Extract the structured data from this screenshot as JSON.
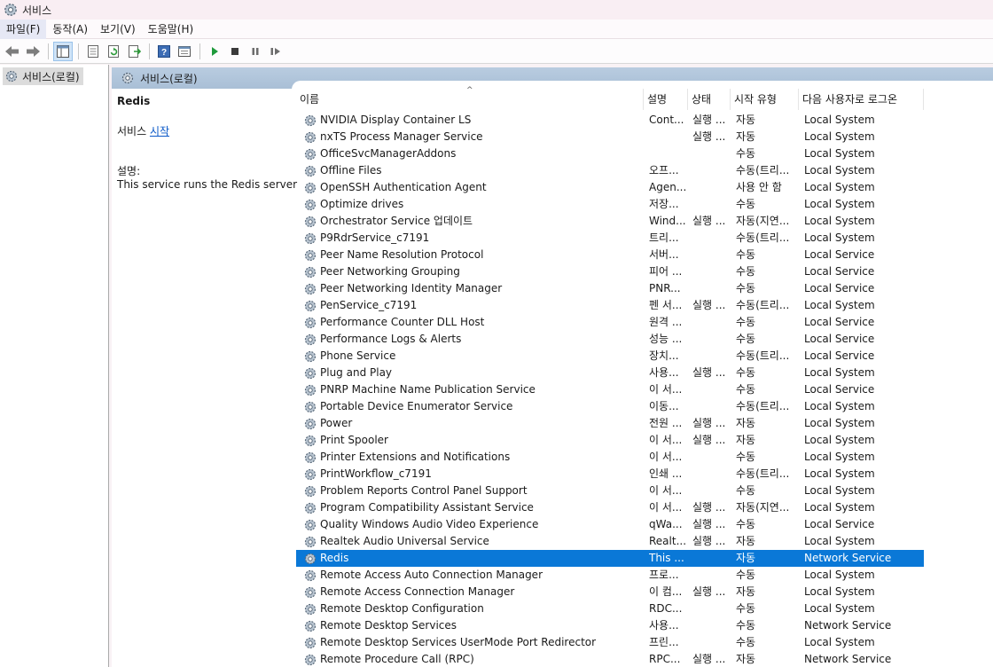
{
  "window": {
    "title": "서비스"
  },
  "menu": [
    "파일(F)",
    "동작(A)",
    "보기(V)",
    "도움말(H)"
  ],
  "toolbar": {
    "buttons": [
      "back-icon",
      "forward-icon",
      "show-hide-tree-icon",
      "properties-icon",
      "refresh-icon",
      "export-list-icon",
      "help-icon",
      "view-icon",
      "play-icon",
      "stop-icon",
      "pause-icon",
      "restart-icon"
    ]
  },
  "tree": {
    "root_label": "서비스(로컬)"
  },
  "pane": {
    "header": "서비스(로컬)"
  },
  "details": {
    "name": "Redis",
    "start_prefix": "서비스 ",
    "start_link": "시작",
    "description_label": "설명:",
    "description": "This service runs the Redis server"
  },
  "columns": {
    "name": "이름",
    "desc": "설명",
    "status": "상태",
    "start": "시작 유형",
    "logon": "다음 사용자로 로그온"
  },
  "services": [
    [
      "NVIDIA Display Container LS",
      "Cont...",
      "실행 ...",
      "자동",
      "Local System"
    ],
    [
      "nxTS Process Manager Service",
      "",
      "실행 ...",
      "자동",
      "Local System"
    ],
    [
      "OfficeSvcManagerAddons",
      "",
      "",
      "수동",
      "Local System"
    ],
    [
      "Offline Files",
      "오프...",
      "",
      "수동(트리...",
      "Local System"
    ],
    [
      "OpenSSH Authentication Agent",
      "Agen...",
      "",
      "사용 안 함",
      "Local System"
    ],
    [
      "Optimize drives",
      "저장...",
      "",
      "수동",
      "Local System"
    ],
    [
      "Orchestrator Service 업데이트",
      "Wind...",
      "실행 ...",
      "자동(지연...",
      "Local System"
    ],
    [
      "P9RdrService_c7191",
      "트리...",
      "",
      "수동(트리...",
      "Local System"
    ],
    [
      "Peer Name Resolution Protocol",
      "서버...",
      "",
      "수동",
      "Local Service"
    ],
    [
      "Peer Networking Grouping",
      "피어 ...",
      "",
      "수동",
      "Local Service"
    ],
    [
      "Peer Networking Identity Manager",
      "PNR...",
      "",
      "수동",
      "Local Service"
    ],
    [
      "PenService_c7191",
      "펜 서...",
      "실행 ...",
      "수동(트리...",
      "Local System"
    ],
    [
      "Performance Counter DLL Host",
      "원격 ...",
      "",
      "수동",
      "Local Service"
    ],
    [
      "Performance Logs & Alerts",
      "성능 ...",
      "",
      "수동",
      "Local Service"
    ],
    [
      "Phone Service",
      "장치...",
      "",
      "수동(트리...",
      "Local Service"
    ],
    [
      "Plug and Play",
      "사용...",
      "실행 ...",
      "수동",
      "Local System"
    ],
    [
      "PNRP Machine Name Publication Service",
      "이 서...",
      "",
      "수동",
      "Local Service"
    ],
    [
      "Portable Device Enumerator Service",
      "이동...",
      "",
      "수동(트리...",
      "Local System"
    ],
    [
      "Power",
      "전원 ...",
      "실행 ...",
      "자동",
      "Local System"
    ],
    [
      "Print Spooler",
      "이 서...",
      "실행 ...",
      "자동",
      "Local System"
    ],
    [
      "Printer Extensions and Notifications",
      "이 서...",
      "",
      "수동",
      "Local System"
    ],
    [
      "PrintWorkflow_c7191",
      "인쇄 ...",
      "",
      "수동(트리...",
      "Local System"
    ],
    [
      "Problem Reports Control Panel Support",
      "이 서...",
      "",
      "수동",
      "Local System"
    ],
    [
      "Program Compatibility Assistant Service",
      "이 서...",
      "실행 ...",
      "자동(지연...",
      "Local System"
    ],
    [
      "Quality Windows Audio Video Experience",
      "qWa...",
      "실행 ...",
      "수동",
      "Local Service"
    ],
    [
      "Realtek Audio Universal Service",
      "Realt...",
      "실행 ...",
      "자동",
      "Local System"
    ],
    [
      "Redis",
      "This ...",
      "",
      "자동",
      "Network Service"
    ],
    [
      "Remote Access Auto Connection Manager",
      "프로...",
      "",
      "수동",
      "Local System"
    ],
    [
      "Remote Access Connection Manager",
      "이 컴...",
      "실행 ...",
      "자동",
      "Local System"
    ],
    [
      "Remote Desktop Configuration",
      "RDC...",
      "",
      "수동",
      "Local System"
    ],
    [
      "Remote Desktop Services",
      "사용...",
      "",
      "수동",
      "Network Service"
    ],
    [
      "Remote Desktop Services UserMode Port Redirector",
      "프린...",
      "",
      "수동",
      "Local System"
    ],
    [
      "Remote Procedure Call (RPC)",
      "RPC...",
      "실행 ...",
      "자동",
      "Network Service"
    ]
  ],
  "selected_service": "Redis",
  "colors": {
    "selection": "#0a78d7",
    "pane_header": "#b9cce0",
    "link": "#0a58c8"
  }
}
